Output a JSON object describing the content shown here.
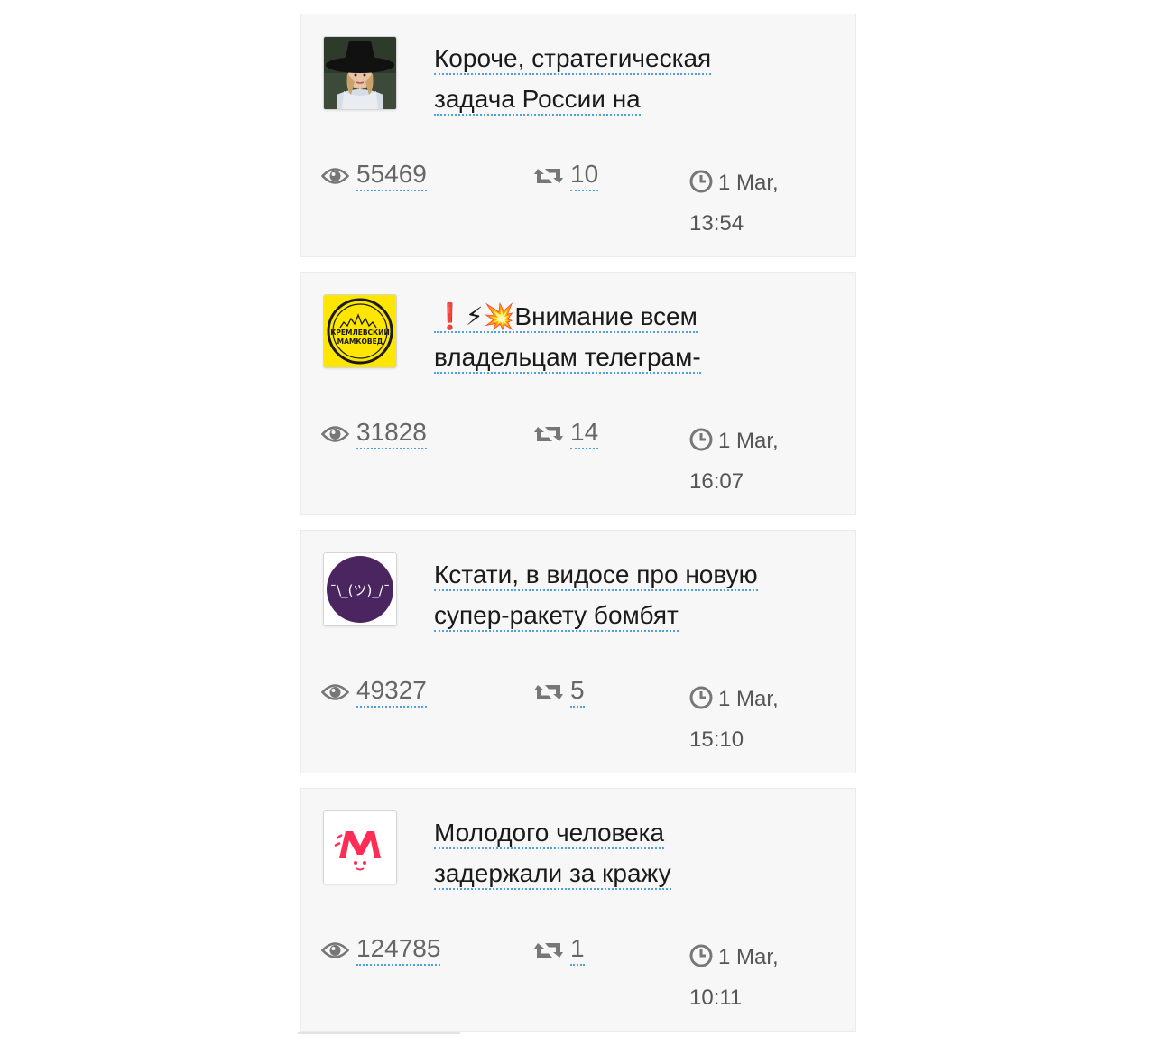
{
  "posts": [
    {
      "avatar_icon": "woman-in-black-hat-avatar",
      "title_line1": "Короче, стратегическая",
      "title_line2": "задача России на",
      "views": "55469",
      "shares": "10",
      "date": "1 Mar,",
      "time": "13:54"
    },
    {
      "avatar_icon": "kremlevsky-mamkoved-logo",
      "avatar_text1": "КРЕМЛЕВСКИЙ",
      "avatar_text2": "МАМКОВЕД",
      "title_line1": "❗⚡💥Внимание всем",
      "title_line2": "владельцам телеграм-",
      "views": "31828",
      "shares": "14",
      "date": "1 Mar,",
      "time": "16:07"
    },
    {
      "avatar_icon": "shrug-emoticon-logo",
      "avatar_text": "¯\\_(ツ)_/¯",
      "title_line1": "Кстати, в видосе про новую",
      "title_line2": "супер-ракету бомбят",
      "views": "49327",
      "shares": "5",
      "date": "1 Mar,",
      "time": "15:10"
    },
    {
      "avatar_icon": "red-letter-m-logo",
      "title_line1": "Молодого человека",
      "title_line2": "задержали за кражу",
      "views": "124785",
      "shares": "1",
      "date": "1 Mar,",
      "time": "10:11"
    }
  ],
  "icons": {
    "views": "eye-icon",
    "shares": "repost-icon",
    "time": "clock-icon"
  },
  "colors": {
    "card_bg": "#f7f7f7",
    "link_underline": "#4aa3df",
    "stat_text": "#666666",
    "logo_yellow": "#ffe600",
    "logo_purple": "#4a2560",
    "logo_red": "#ff2d55"
  }
}
